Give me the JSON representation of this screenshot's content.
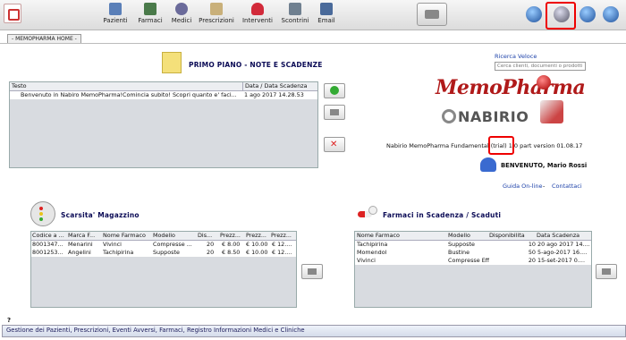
{
  "toolbar": {
    "buttons": [
      {
        "label": "Pazienti",
        "icon": "patients-icon",
        "color": "#5a7fb8"
      },
      {
        "label": "Farmaci",
        "icon": "pills-icon",
        "color": "#4a7a4a"
      },
      {
        "label": "Medici",
        "icon": "doctor-icon",
        "color": "#6a6a9a"
      },
      {
        "label": "Prescrizioni",
        "icon": "prescription-icon",
        "color": "#c9b07a"
      },
      {
        "label": "Interventi",
        "icon": "heart-icon",
        "color": "#d22a3a"
      },
      {
        "label": "Scontrini",
        "icon": "receipt-icon",
        "color": "#708090"
      },
      {
        "label": "Email",
        "icon": "email-icon",
        "color": "#4a6a9a"
      }
    ]
  },
  "tab": {
    "label": "- MEMOPHARMA HOME -"
  },
  "notes": {
    "title": "PRIMO PIANO  -  NOTE E SCADENZE",
    "columns": [
      "Testo",
      "Data / Data Scadenza"
    ],
    "rows": [
      [
        "Benvenuto in Nabiro MemoPharma!Comincia subito! Scopri quanto e' faci...",
        "1 ago 2017 14.28.53"
      ]
    ]
  },
  "search": {
    "label": "Ricerca Veloce",
    "placeholder": "Cerca clienti, documenti o prodotti"
  },
  "brand": {
    "logo_text": "MemoPharma",
    "company": "NABIRIO"
  },
  "version_text": "Nabirio MemoPharma Fundamental (trial) 1.0 part version 01.08.17",
  "welcome_text": "BENVENUTO, Mario Rossi",
  "links": {
    "guide": "Guida On-line",
    "contacts": "Contattaci"
  },
  "stock": {
    "title": "Scarsita' Magazzino",
    "columns": [
      "Codice a ...",
      "Marca F...",
      "Nome Farmaco",
      "Modello",
      "Dis...",
      "Prezz...",
      "Prezz...",
      "Prezz..."
    ],
    "rows": [
      [
        "8001347...",
        "Menarini",
        "Vivinci",
        "Compresse ...",
        "20",
        "€ 8.00",
        "€ 10.00",
        "€ 12...."
      ],
      [
        "8001253...",
        "Angelini",
        "Tachipirina",
        "Supposte",
        "20",
        "€ 8.50",
        "€ 10.00",
        "€ 12...."
      ]
    ]
  },
  "expiry": {
    "title": "Farmaci in Scadenza / Scaduti",
    "columns": [
      "Nome Farmaco",
      "Modello",
      "Disponibilita",
      "Data Scadenza"
    ],
    "rows": [
      [
        "Tachipirina",
        "Supposte",
        "10",
        "20 ago 2017 14...."
      ],
      [
        "Momendol",
        "Bustine",
        "50",
        "5-ago-2017 16...."
      ],
      [
        "Vivinci",
        "Compresse Eff.",
        "20",
        "15-set-2017 0...."
      ]
    ]
  },
  "help_mark": "?",
  "footer": "Gestione dei Pazienti, Prescrizioni, Eventi Avversi, Farmaci, Registro Informazioni Medici e Cliniche"
}
